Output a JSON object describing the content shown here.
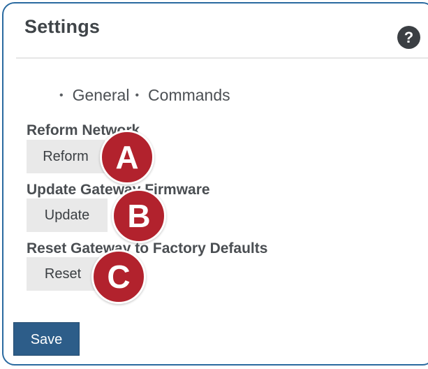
{
  "panel": {
    "title": "Settings",
    "help_icon_glyph": "?"
  },
  "nav": {
    "items": [
      {
        "bullet": "•",
        "label": "General"
      },
      {
        "bullet": "•",
        "label": "Commands"
      }
    ]
  },
  "sections": [
    {
      "label": "Reform Network",
      "button": "Reform",
      "marker": "A"
    },
    {
      "label": "Update Gateway Firmware",
      "button": "Update",
      "marker": "B"
    },
    {
      "label": "Reset Gateway to Factory Defaults",
      "button": "Reset",
      "marker": "C"
    }
  ],
  "footer": {
    "save_label": "Save"
  },
  "colors": {
    "border": "#2a6aa0",
    "marker": "#b2222d",
    "save_button": "#2d5d89",
    "button_bg": "#e9e9e9"
  },
  "icons": {
    "help": "help-icon",
    "bullet": "bullet-icon"
  }
}
